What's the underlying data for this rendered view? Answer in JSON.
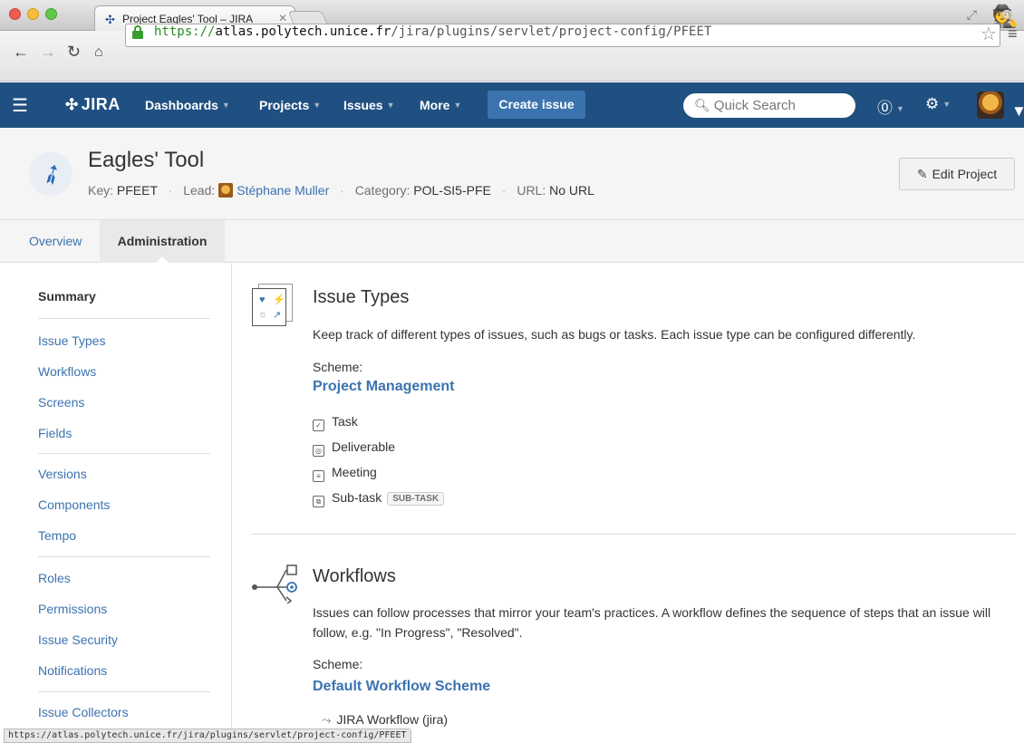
{
  "browser": {
    "tab_title": "Project Eagles' Tool – JIRA",
    "url_proto": "https://",
    "url_host": "atlas.polytech.unice.fr",
    "url_path": "/jira/plugins/servlet/project-config/PFEET",
    "status_url": "https://atlas.polytech.unice.fr/jira/plugins/servlet/project-config/PFEET"
  },
  "header": {
    "logo": "JIRA",
    "nav": [
      "Dashboards",
      "Projects",
      "Issues",
      "More"
    ],
    "create_label": "Create issue",
    "search_placeholder": "Quick Search",
    "brand_color": "#205081"
  },
  "project": {
    "name": "Eagles' Tool",
    "key_label": "Key:",
    "key": "PFEET",
    "lead_label": "Lead:",
    "lead": "Stéphane Muller",
    "category_label": "Category:",
    "category": "POL-SI5-PFE",
    "url_label": "URL:",
    "url": "No URL",
    "edit_label": "Edit Project"
  },
  "tabs": {
    "overview": "Overview",
    "administration": "Administration"
  },
  "sidebar": {
    "summary": "Summary",
    "group1": [
      "Issue Types",
      "Workflows",
      "Screens",
      "Fields"
    ],
    "group2": [
      "Versions",
      "Components",
      "Tempo"
    ],
    "group3": [
      "Roles",
      "Permissions",
      "Issue Security",
      "Notifications"
    ],
    "group4": [
      "Issue Collectors"
    ]
  },
  "issue_types": {
    "title": "Issue Types",
    "description": "Keep track of different types of issues, such as bugs or tasks. Each issue type can be configured differently.",
    "scheme_label": "Scheme:",
    "scheme": "Project Management",
    "types": [
      "Task",
      "Deliverable",
      "Meeting",
      "Sub-task"
    ],
    "subtask_lozenge": "SUB-TASK"
  },
  "workflows": {
    "title": "Workflows",
    "description": "Issues can follow processes that mirror your team's practices. A workflow defines the sequence of steps that an issue will follow, e.g. \"In Progress\", \"Resolved\".",
    "scheme_label": "Scheme:",
    "scheme": "Default Workflow Scheme",
    "item": "JIRA Workflow (jira)"
  }
}
